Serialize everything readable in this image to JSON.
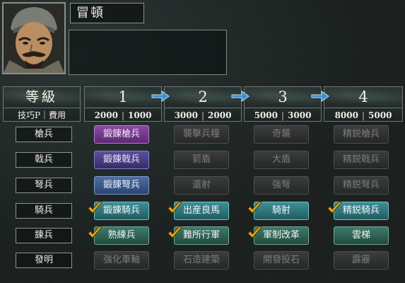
{
  "general": {
    "name": "冒頓"
  },
  "table": {
    "label_header": "等級",
    "label_sub": "技巧P｜費用",
    "levels": [
      {
        "num": "1",
        "p": "2000",
        "cost": "1000"
      },
      {
        "num": "2",
        "p": "3000",
        "cost": "2000"
      },
      {
        "num": "3",
        "p": "5000",
        "cost": "3000"
      },
      {
        "num": "4",
        "p": "8000",
        "cost": "5000"
      }
    ],
    "rows": [
      {
        "label": "槍兵",
        "cells": [
          {
            "text": "鍛錬槍兵",
            "style": "purple",
            "checked": false
          },
          {
            "text": "襲擊兵糧",
            "style": "dark",
            "checked": false
          },
          {
            "text": "奇襲",
            "style": "dark",
            "checked": false
          },
          {
            "text": "精鋭槍兵",
            "style": "dark",
            "checked": false
          }
        ]
      },
      {
        "label": "戟兵",
        "cells": [
          {
            "text": "鍛錬戟兵",
            "style": "indigo",
            "checked": false
          },
          {
            "text": "箭盾",
            "style": "dark",
            "checked": false
          },
          {
            "text": "大盾",
            "style": "dark",
            "checked": false
          },
          {
            "text": "精鋭戟兵",
            "style": "dark",
            "checked": false
          }
        ]
      },
      {
        "label": "弩兵",
        "cells": [
          {
            "text": "鍛錬弩兵",
            "style": "blue",
            "checked": false
          },
          {
            "text": "還射",
            "style": "dark",
            "checked": false
          },
          {
            "text": "強弩",
            "style": "dark",
            "checked": false
          },
          {
            "text": "精鋭弩兵",
            "style": "dark",
            "checked": false
          }
        ]
      },
      {
        "label": "騎兵",
        "cells": [
          {
            "text": "鍛錬騎兵",
            "style": "teal",
            "checked": true
          },
          {
            "text": "出産良馬",
            "style": "teal",
            "checked": true
          },
          {
            "text": "騎射",
            "style": "teal",
            "checked": true
          },
          {
            "text": "精鋭騎兵",
            "style": "teal",
            "checked": true
          }
        ]
      },
      {
        "label": "錬兵",
        "cells": [
          {
            "text": "熟練兵",
            "style": "green",
            "checked": true
          },
          {
            "text": "難所行軍",
            "style": "green",
            "checked": true
          },
          {
            "text": "軍制改革",
            "style": "green",
            "checked": true
          },
          {
            "text": "雲梯",
            "style": "green",
            "checked": false
          }
        ]
      },
      {
        "label": "發明",
        "cells": [
          {
            "text": "強化車軸",
            "style": "dark",
            "checked": false
          },
          {
            "text": "石造建築",
            "style": "dark",
            "checked": false
          },
          {
            "text": "開發投石",
            "style": "dark",
            "checked": false
          },
          {
            "text": "霹靂",
            "style": "dark",
            "checked": false
          }
        ]
      }
    ]
  },
  "colors": {
    "check": "#e8b21c",
    "arrow": "#3a8fd6"
  }
}
